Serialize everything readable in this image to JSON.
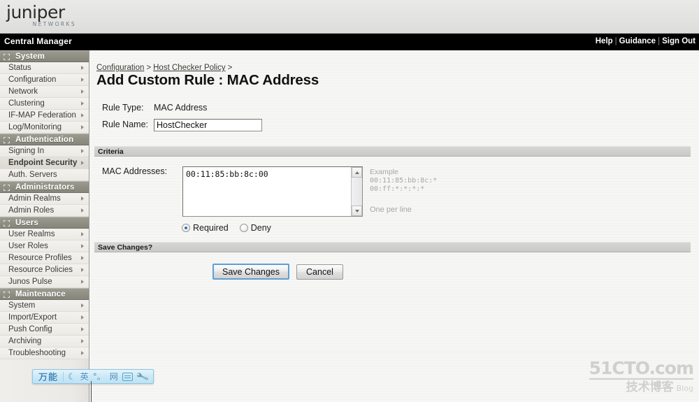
{
  "brand": {
    "logo_word": "juniper",
    "logo_sub": "NETWORKS"
  },
  "header": {
    "app_title": "Central Manager",
    "links": [
      {
        "label": "Help"
      },
      {
        "label": "Guidance"
      },
      {
        "label": "Sign Out"
      }
    ],
    "separator": "|"
  },
  "sidebar": {
    "groups": [
      {
        "title": "System",
        "items": [
          {
            "label": "Status",
            "arrow": true,
            "active": false
          },
          {
            "label": "Configuration",
            "arrow": true,
            "active": false
          },
          {
            "label": "Network",
            "arrow": true,
            "active": false
          },
          {
            "label": "Clustering",
            "arrow": true,
            "active": false
          },
          {
            "label": "IF-MAP Federation",
            "arrow": true,
            "active": false
          },
          {
            "label": "Log/Monitoring",
            "arrow": true,
            "active": false
          }
        ]
      },
      {
        "title": "Authentication",
        "items": [
          {
            "label": "Signing In",
            "arrow": true,
            "active": false
          },
          {
            "label": "Endpoint Security",
            "arrow": true,
            "active": true
          },
          {
            "label": "Auth. Servers",
            "arrow": false,
            "active": false
          }
        ]
      },
      {
        "title": "Administrators",
        "items": [
          {
            "label": "Admin Realms",
            "arrow": true,
            "active": false
          },
          {
            "label": "Admin Roles",
            "arrow": true,
            "active": false
          }
        ]
      },
      {
        "title": "Users",
        "items": [
          {
            "label": "User Realms",
            "arrow": true,
            "active": false
          },
          {
            "label": "User Roles",
            "arrow": true,
            "active": false
          },
          {
            "label": "Resource Profiles",
            "arrow": true,
            "active": false
          },
          {
            "label": "Resource Policies",
            "arrow": true,
            "active": false
          },
          {
            "label": "Junos Pulse",
            "arrow": true,
            "active": false
          }
        ]
      },
      {
        "title": "Maintenance",
        "items": [
          {
            "label": "System",
            "arrow": true,
            "active": false
          },
          {
            "label": "Import/Export",
            "arrow": true,
            "active": false
          },
          {
            "label": "Push Config",
            "arrow": true,
            "active": false
          },
          {
            "label": "Archiving",
            "arrow": true,
            "active": false
          },
          {
            "label": "Troubleshooting",
            "arrow": true,
            "active": false
          }
        ]
      }
    ]
  },
  "breadcrumb": {
    "item1": "Configuration",
    "sep1": ">",
    "item2": "Host Checker Policy",
    "sep2": ">"
  },
  "page": {
    "title": "Add Custom Rule : MAC Address"
  },
  "form": {
    "rule_type_label": "Rule Type:",
    "rule_type_value": "MAC Address",
    "rule_name_label": "Rule Name:",
    "rule_name_value": "HostChecker"
  },
  "criteria": {
    "section_title": "Criteria",
    "mac_label": "MAC Addresses:",
    "mac_value": "00:11:85:bb:8c:00",
    "example_title": "Example",
    "example_line1": "00:11:85:bb:8c:*",
    "example_line2": "00:ff:*:*:*:*",
    "one_per_line": "One per line",
    "radio_required": "Required",
    "radio_deny": "Deny",
    "selected": "Required"
  },
  "save": {
    "section_title": "Save Changes?",
    "save_label": "Save Changes",
    "cancel_label": "Cancel"
  },
  "ime": {
    "logo": "万能",
    "moon": "☾",
    "lang": "英",
    "punct": "°。",
    "net": "网",
    "keyboard": "keyboard-icon",
    "wrench": "🔧"
  },
  "watermark": {
    "line1": "51CTO.com",
    "line2": "技术博客",
    "blog": "Blog"
  },
  "colors": {
    "black_bar": "#000000",
    "nav_section": "#8f8f84",
    "accent_focus": "#5b9fd4",
    "radio_dot": "#2f6fb5",
    "ime_blue": "#3f86bb"
  }
}
